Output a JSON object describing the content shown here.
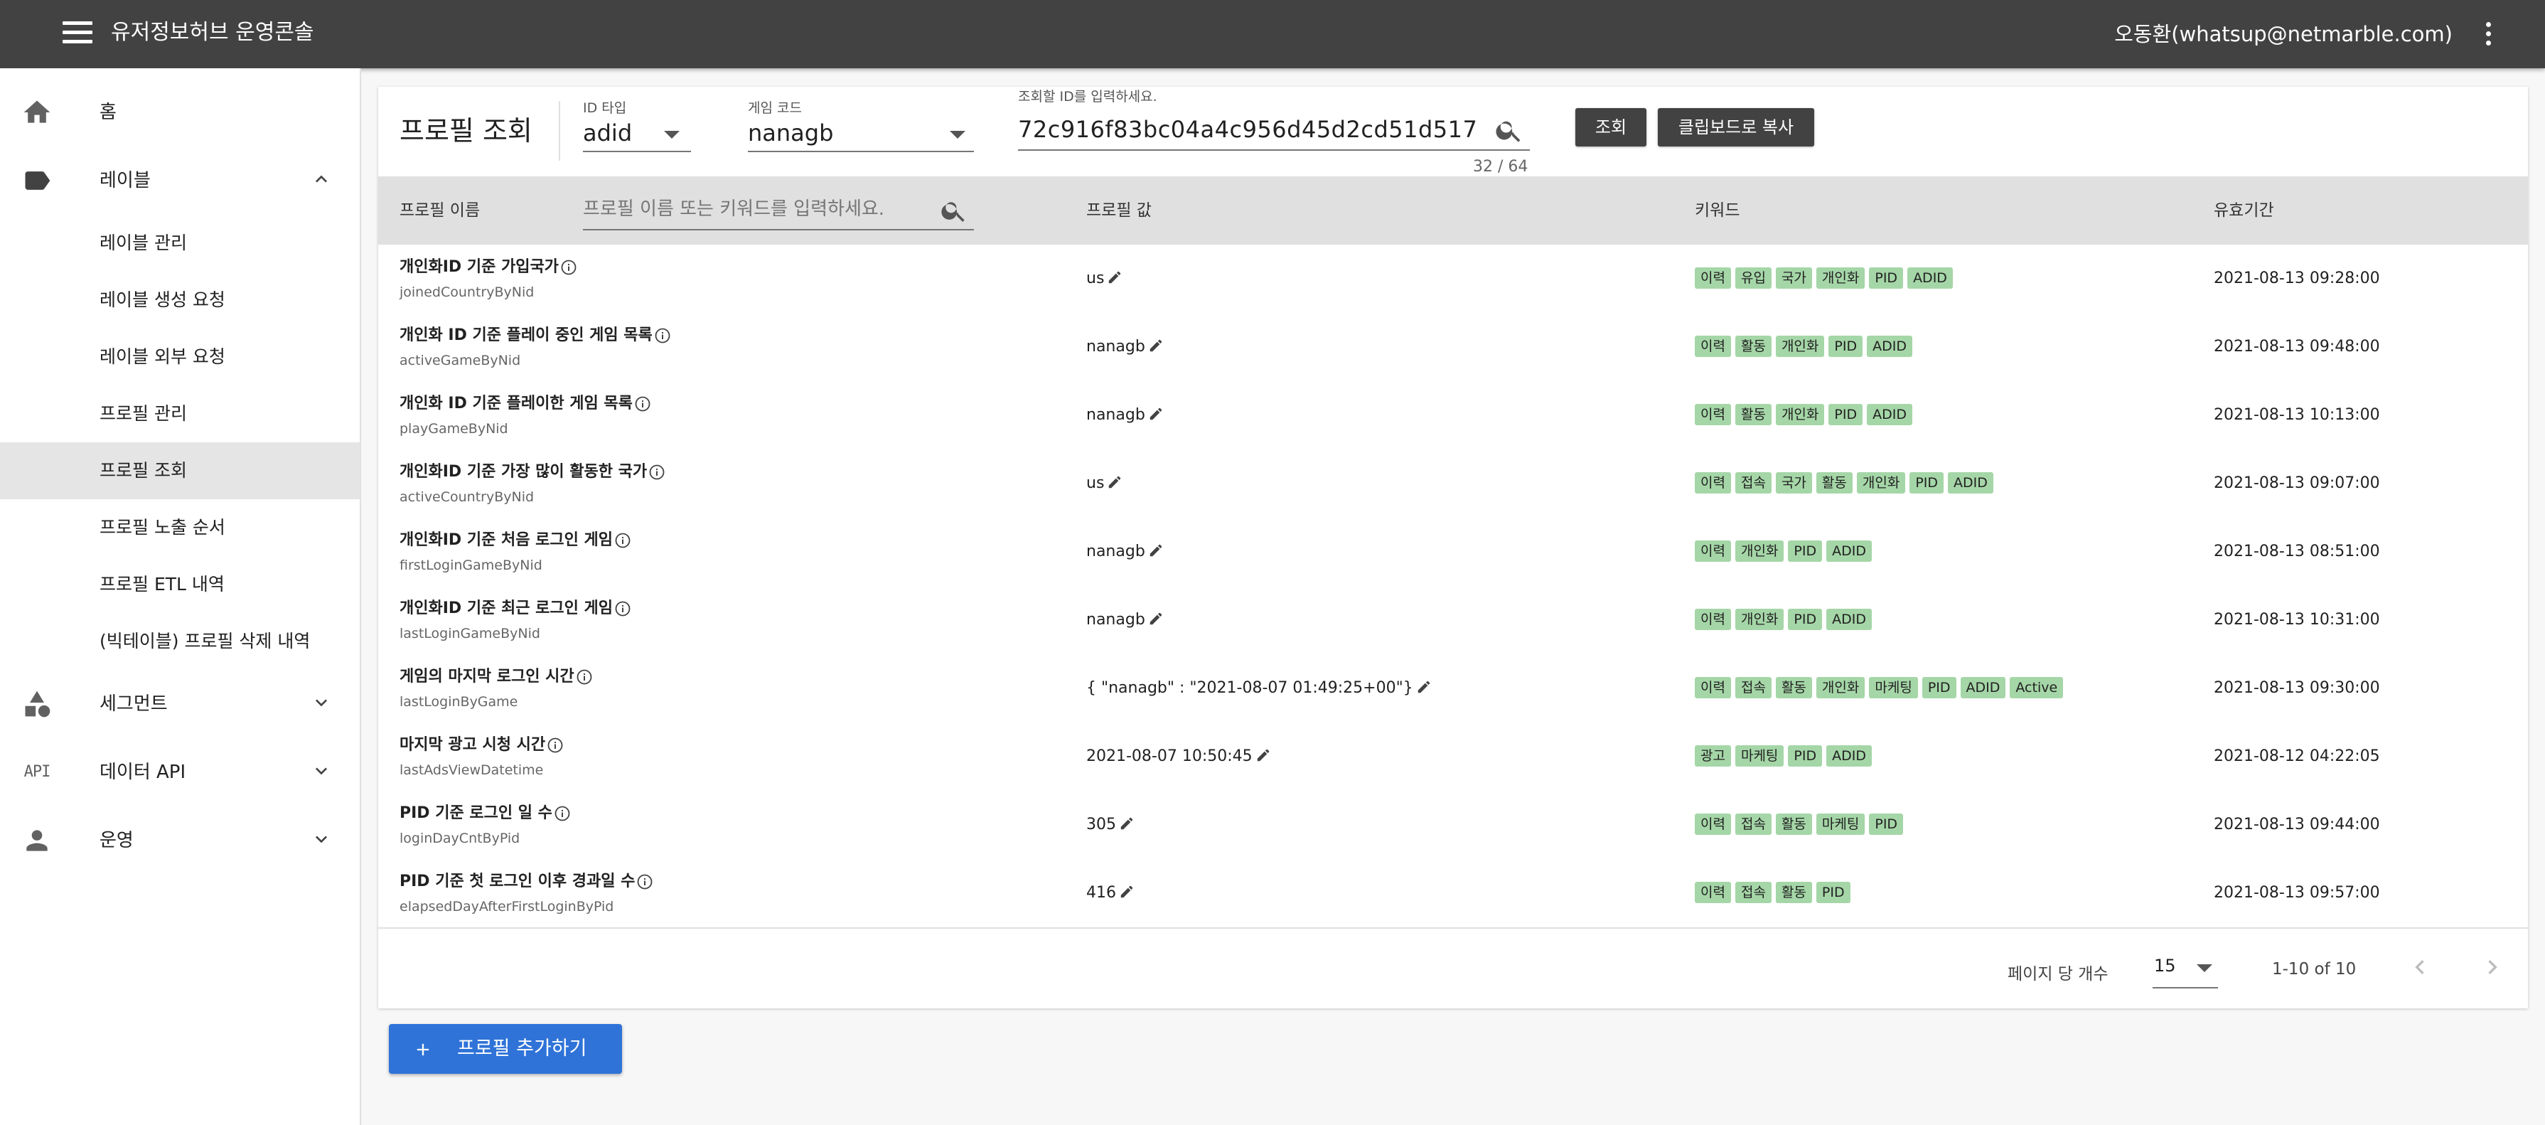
{
  "header": {
    "app_title": "유저정보허브 운영콘솔",
    "user": "오동환(whatsup@netmarble.com)"
  },
  "sidebar": {
    "home": "홈",
    "label_group": "레이블",
    "label_items": [
      "레이블 관리",
      "레이블 생성 요청",
      "레이블 외부 요청",
      "프로필 관리",
      "프로필 조회",
      "프로필 노출 순서",
      "프로필 ETL 내역",
      "(빅테이블) 프로필 삭제 내역"
    ],
    "active_item": "프로필 조회",
    "segment": "세그먼트",
    "data_api": "데이터 API",
    "data_api_icon_text": "API",
    "ops": "운영"
  },
  "search": {
    "page_title": "프로필 조회",
    "id_type_label": "ID 타입",
    "id_type_value": "adid",
    "game_code_label": "게임 코드",
    "game_code_value": "nanagb",
    "id_input_label": "조회할 ID를 입력하세요.",
    "id_input_value": "72c916f83bc04a4c956d45d2cd51d517",
    "counter": "32 / 64",
    "query_button": "조회",
    "copy_button": "클립보드로 복사"
  },
  "table": {
    "headers": {
      "name": "프로필 이름",
      "value": "프로필 값",
      "keywords": "키워드",
      "expiry": "유효기간"
    },
    "filter_placeholder": "프로필 이름 또는 키워드를 입력하세요.",
    "rows": [
      {
        "name": "개인화ID 기준 가입국가",
        "key": "joinedCountryByNid",
        "value": "us",
        "keywords": [
          "이력",
          "유입",
          "국가",
          "개인화",
          "PID",
          "ADID"
        ],
        "expiry": "2021-08-13 09:28:00"
      },
      {
        "name": "개인화 ID 기준 플레이 중인 게임 목록",
        "key": "activeGameByNid",
        "value": "nanagb",
        "keywords": [
          "이력",
          "활동",
          "개인화",
          "PID",
          "ADID"
        ],
        "expiry": "2021-08-13 09:48:00"
      },
      {
        "name": "개인화 ID 기준 플레이한 게임 목록",
        "key": "playGameByNid",
        "value": "nanagb",
        "keywords": [
          "이력",
          "활동",
          "개인화",
          "PID",
          "ADID"
        ],
        "expiry": "2021-08-13 10:13:00"
      },
      {
        "name": "개인화ID 기준 가장 많이 활동한 국가",
        "key": "activeCountryByNid",
        "value": "us",
        "keywords": [
          "이력",
          "접속",
          "국가",
          "활동",
          "개인화",
          "PID",
          "ADID"
        ],
        "expiry": "2021-08-13 09:07:00"
      },
      {
        "name": "개인화ID 기준 처음 로그인 게임",
        "key": "firstLoginGameByNid",
        "value": "nanagb",
        "keywords": [
          "이력",
          "개인화",
          "PID",
          "ADID"
        ],
        "expiry": "2021-08-13 08:51:00"
      },
      {
        "name": "개인화ID 기준 최근 로그인 게임",
        "key": "lastLoginGameByNid",
        "value": "nanagb",
        "keywords": [
          "이력",
          "개인화",
          "PID",
          "ADID"
        ],
        "expiry": "2021-08-13 10:31:00"
      },
      {
        "name": "게임의 마지막 로그인 시간",
        "key": "lastLoginByGame",
        "value": "{ \"nanagb\" : \"2021-08-07 01:49:25+00\"}",
        "keywords": [
          "이력",
          "접속",
          "활동",
          "개인화",
          "마케팅",
          "PID",
          "ADID",
          "Active"
        ],
        "expiry": "2021-08-13 09:30:00"
      },
      {
        "name": "마지막 광고 시청 시간",
        "key": "lastAdsViewDatetime",
        "value": "2021-08-07 10:50:45",
        "keywords": [
          "광고",
          "마케팅",
          "PID",
          "ADID"
        ],
        "expiry": "2021-08-12 04:22:05"
      },
      {
        "name": "PID 기준 로그인 일 수",
        "key": "loginDayCntByPid",
        "value": "305",
        "keywords": [
          "이력",
          "접속",
          "활동",
          "마케팅",
          "PID"
        ],
        "expiry": "2021-08-13 09:44:00"
      },
      {
        "name": "PID 기준 첫 로그인 이후 경과일 수",
        "key": "elapsedDayAfterFirstLoginByPid",
        "value": "416",
        "keywords": [
          "이력",
          "접속",
          "활동",
          "PID"
        ],
        "expiry": "2021-08-13 09:57:00"
      }
    ]
  },
  "pagination": {
    "rows_per_page_label": "페이지 당 개수",
    "rows_per_page": "15",
    "range": "1-10 of 10"
  },
  "add_button": "프로필 추가하기",
  "colors": {
    "topbar": "#424242",
    "chip": "#a5d6a7",
    "primary_button": "#2f73d8",
    "active_nav": "#e5e5e5"
  },
  "icons": [
    "menu-icon",
    "more-vert-icon",
    "home-icon",
    "label-icon",
    "chevron-up-icon",
    "category-icon",
    "api-icon",
    "person-icon",
    "chevron-down-icon",
    "search-icon",
    "info-icon",
    "edit-icon",
    "chevron-left-icon",
    "chevron-right-icon",
    "plus-icon"
  ]
}
